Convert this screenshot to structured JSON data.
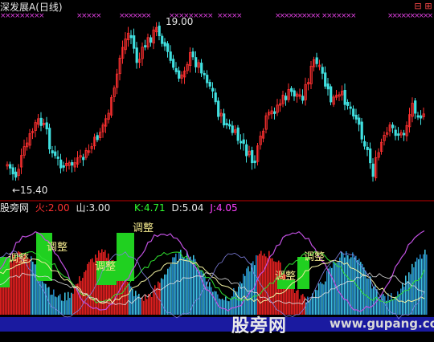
{
  "title": {
    "name": "深发展A",
    "period": "(日线)"
  },
  "price_labels": {
    "high": "19.00",
    "low": "←15.40"
  },
  "indicator": {
    "name": "股旁网",
    "values": [
      {
        "label": "火:",
        "value": "2.00",
        "color": "#ff3030"
      },
      {
        "label": "山:",
        "value": "3.00",
        "color": "#e8e8e8"
      },
      {
        "label": "K:",
        "value": "4.71",
        "color": "#30ff30"
      },
      {
        "label": "D:",
        "value": "5.04",
        "color": "#e8e8e8"
      },
      {
        "label": "J:",
        "value": "4.05",
        "color": "#ff40ff"
      }
    ]
  },
  "annotation_text": "调整",
  "signal_marks": "××××",
  "watermark": {
    "site": "股旁网",
    "www": "www.",
    "domain": "gupang.com"
  },
  "icons": {
    "left": "minus-box-icon",
    "right": "expand-box-icon"
  },
  "colors": {
    "up": "#ff3030",
    "down": "#40e0e0",
    "signal": "#e040e0",
    "level_line": "#c00000"
  }
}
